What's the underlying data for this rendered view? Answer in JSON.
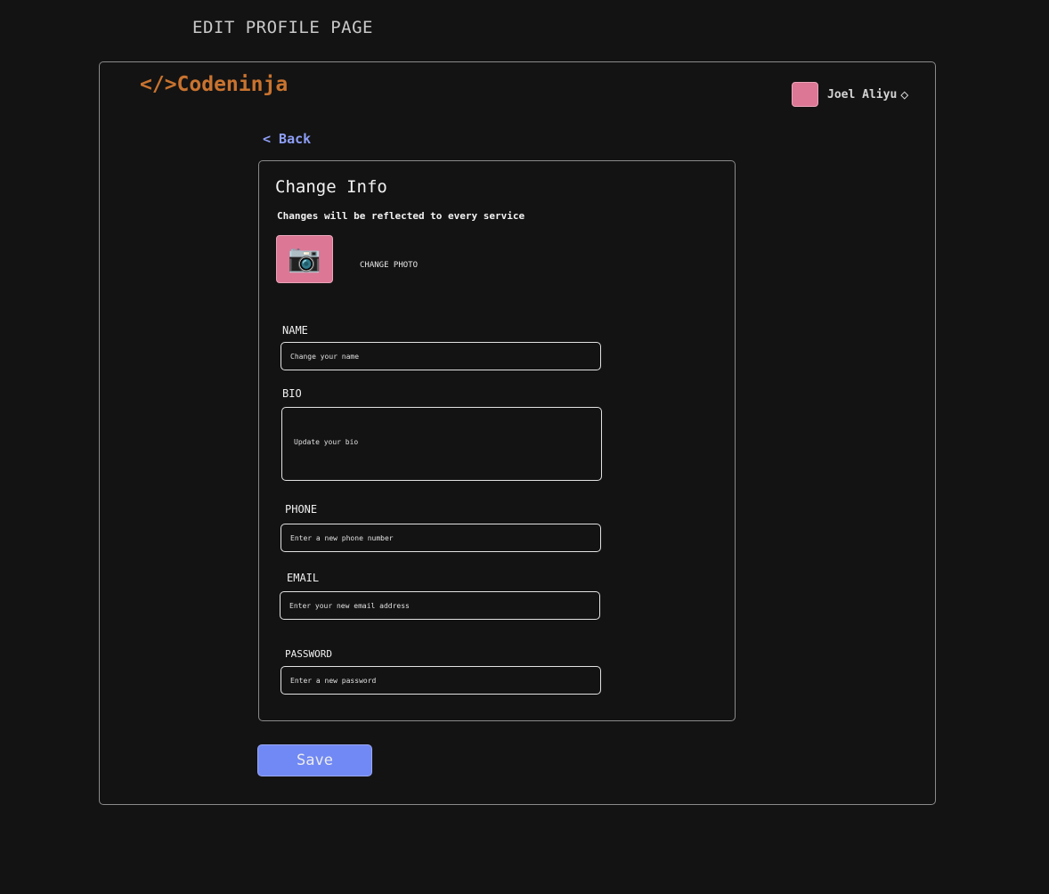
{
  "page": {
    "heading": "EDIT PROFILE PAGE"
  },
  "header": {
    "logo": "</>Codeninja",
    "user_name": "Joel Aliyu",
    "user_menu_glyph": "◇"
  },
  "nav": {
    "back_label": "< Back"
  },
  "card": {
    "title": "Change Info",
    "subtitle": "Changes will be reflected to every service",
    "photo_icon": "📷",
    "change_photo_label": "CHANGE PHOTO"
  },
  "form": {
    "name": {
      "label": "NAME",
      "placeholder": "Change your name",
      "value": ""
    },
    "bio": {
      "label": "BIO",
      "placeholder": "Update your bio",
      "value": ""
    },
    "phone": {
      "label": "PHONE",
      "placeholder": "Enter a new phone number",
      "value": ""
    },
    "email": {
      "label": "EMAIL",
      "placeholder": "Enter your new email address",
      "value": ""
    },
    "password": {
      "label": "PASSWORD",
      "placeholder": "Enter a new password",
      "value": ""
    },
    "save_label": "Save"
  },
  "colors": {
    "background": "#131313",
    "logo": "#c9732f",
    "accent": "#7189f4",
    "link": "#8e9ef7",
    "avatar": "#dc7796"
  }
}
